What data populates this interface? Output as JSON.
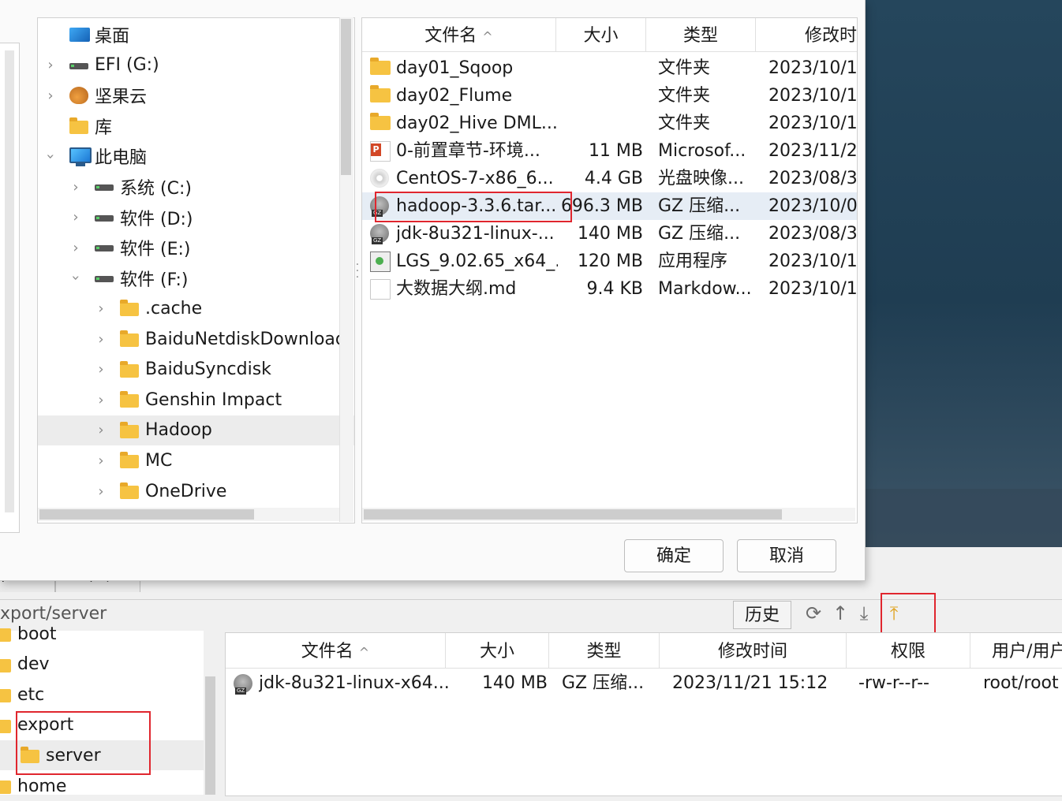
{
  "dialog": {
    "tree": [
      {
        "label": "桌面",
        "icon": "desktop-icon",
        "indent": 0,
        "chevron": "none"
      },
      {
        "label": "EFI (G:)",
        "icon": "drive-icon",
        "indent": 0,
        "chevron": "closed"
      },
      {
        "label": "坚果云",
        "icon": "nutstore-icon",
        "indent": 0,
        "chevron": "closed"
      },
      {
        "label": "库",
        "icon": "folder-icon",
        "indent": 0,
        "chevron": "none"
      },
      {
        "label": "此电脑",
        "icon": "computer-icon",
        "indent": 0,
        "chevron": "open"
      },
      {
        "label": "系统 (C:)",
        "icon": "drive-icon",
        "indent": 1,
        "chevron": "closed"
      },
      {
        "label": "软件 (D:)",
        "icon": "drive-icon",
        "indent": 1,
        "chevron": "closed"
      },
      {
        "label": "软件 (E:)",
        "icon": "drive-icon",
        "indent": 1,
        "chevron": "closed"
      },
      {
        "label": "软件 (F:)",
        "icon": "drive-icon",
        "indent": 1,
        "chevron": "open"
      },
      {
        "label": ".cache",
        "icon": "folder-icon",
        "indent": 2,
        "chevron": "closed"
      },
      {
        "label": "BaiduNetdiskDownload",
        "icon": "folder-icon",
        "indent": 2,
        "chevron": "closed"
      },
      {
        "label": "BaiduSyncdisk",
        "icon": "folder-icon",
        "indent": 2,
        "chevron": "closed"
      },
      {
        "label": "Genshin Impact",
        "icon": "folder-icon",
        "indent": 2,
        "chevron": "closed"
      },
      {
        "label": "Hadoop",
        "icon": "folder-icon",
        "indent": 2,
        "chevron": "closed",
        "selected": true
      },
      {
        "label": "MC",
        "icon": "folder-icon",
        "indent": 2,
        "chevron": "closed"
      },
      {
        "label": "OneDrive",
        "icon": "folder-icon",
        "indent": 2,
        "chevron": "closed"
      }
    ],
    "columns": {
      "name": "文件名",
      "size": "大小",
      "type": "类型",
      "modified": "修改时"
    },
    "sort_indicator": "^",
    "files": [
      {
        "name": "day01_Sqoop",
        "size": "",
        "type": "文件夹",
        "modified": "2023/10/1",
        "icon": "folder-icon"
      },
      {
        "name": "day02_Flume",
        "size": "",
        "type": "文件夹",
        "modified": "2023/10/1",
        "icon": "folder-icon"
      },
      {
        "name": "day02_Hive DML...",
        "size": "",
        "type": "文件夹",
        "modified": "2023/10/1",
        "icon": "folder-icon"
      },
      {
        "name": "0-前置章节-环境...",
        "size": "11 MB",
        "type": "Microsof...",
        "modified": "2023/11/2",
        "icon": "powerpoint-icon"
      },
      {
        "name": "CentOS-7-x86_6...",
        "size": "4.4 GB",
        "type": "光盘映像...",
        "modified": "2023/08/3",
        "icon": "disc-image-icon"
      },
      {
        "name": "hadoop-3.3.6.tar...",
        "size": "696.3 MB",
        "type": "GZ 压缩...",
        "modified": "2023/10/0",
        "icon": "gz-archive-icon",
        "selected": true
      },
      {
        "name": "jdk-8u321-linux-...",
        "size": "140 MB",
        "type": "GZ 压缩...",
        "modified": "2023/08/3",
        "icon": "gz-archive-icon"
      },
      {
        "name": "LGS_9.02.65_x64_...",
        "size": "120 MB",
        "type": "应用程序",
        "modified": "2023/10/1",
        "icon": "application-icon"
      },
      {
        "name": "大数据大纲.md",
        "size": "9.4 KB",
        "type": "Markdow...",
        "modified": "2023/10/1",
        "icon": "document-icon"
      }
    ],
    "ok_label": "确定",
    "cancel_label": "取消"
  },
  "main": {
    "path": "xport/server",
    "tab_stubs": [
      "件",
      "命令"
    ],
    "history_label": "历史",
    "toolbar_icons": [
      "refresh-icon",
      "up-directory-icon",
      "download-icon",
      "upload-icon"
    ],
    "remote_tree": [
      {
        "label": "boot",
        "indent": 0
      },
      {
        "label": "dev",
        "indent": 0
      },
      {
        "label": "etc",
        "indent": 0
      },
      {
        "label": "export",
        "indent": 0
      },
      {
        "label": "server",
        "indent": 1,
        "selected": true
      },
      {
        "label": "home",
        "indent": 0
      }
    ],
    "remote_columns": {
      "name": "文件名",
      "size": "大小",
      "type": "类型",
      "modified": "修改时间",
      "perm": "权限",
      "owner": "用户/用户组"
    },
    "remote_files": [
      {
        "name": "jdk-8u321-linux-x64...",
        "size": "140 MB",
        "type": "GZ 压缩...",
        "modified": "2023/11/21 15:12",
        "perm": "-rw-r--r--",
        "owner": "root/root",
        "icon": "gz-archive-icon"
      }
    ]
  },
  "colors": {
    "highlight": "#e0262e",
    "selection": "#e6edf5",
    "folder": "#f6c342",
    "accent_upload": "#e0a320"
  }
}
